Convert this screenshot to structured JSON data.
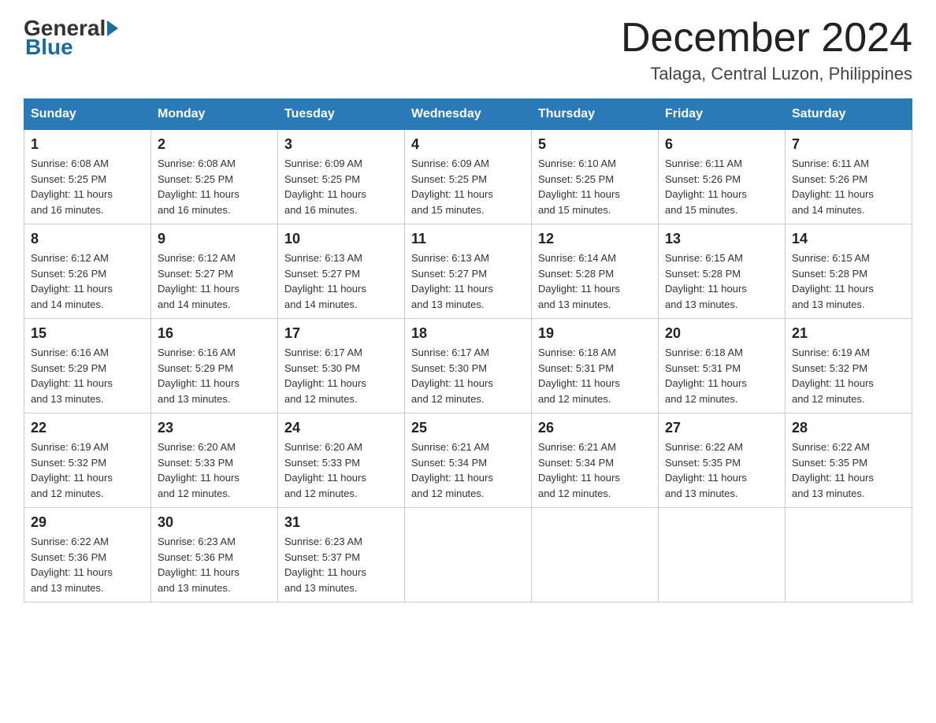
{
  "logo": {
    "general": "General",
    "blue": "Blue"
  },
  "title": "December 2024",
  "subtitle": "Talaga, Central Luzon, Philippines",
  "days_of_week": [
    "Sunday",
    "Monday",
    "Tuesday",
    "Wednesday",
    "Thursday",
    "Friday",
    "Saturday"
  ],
  "weeks": [
    [
      {
        "day": "1",
        "sunrise": "6:08 AM",
        "sunset": "5:25 PM",
        "daylight": "11 hours and 16 minutes."
      },
      {
        "day": "2",
        "sunrise": "6:08 AM",
        "sunset": "5:25 PM",
        "daylight": "11 hours and 16 minutes."
      },
      {
        "day": "3",
        "sunrise": "6:09 AM",
        "sunset": "5:25 PM",
        "daylight": "11 hours and 16 minutes."
      },
      {
        "day": "4",
        "sunrise": "6:09 AM",
        "sunset": "5:25 PM",
        "daylight": "11 hours and 15 minutes."
      },
      {
        "day": "5",
        "sunrise": "6:10 AM",
        "sunset": "5:25 PM",
        "daylight": "11 hours and 15 minutes."
      },
      {
        "day": "6",
        "sunrise": "6:11 AM",
        "sunset": "5:26 PM",
        "daylight": "11 hours and 15 minutes."
      },
      {
        "day": "7",
        "sunrise": "6:11 AM",
        "sunset": "5:26 PM",
        "daylight": "11 hours and 14 minutes."
      }
    ],
    [
      {
        "day": "8",
        "sunrise": "6:12 AM",
        "sunset": "5:26 PM",
        "daylight": "11 hours and 14 minutes."
      },
      {
        "day": "9",
        "sunrise": "6:12 AM",
        "sunset": "5:27 PM",
        "daylight": "11 hours and 14 minutes."
      },
      {
        "day": "10",
        "sunrise": "6:13 AM",
        "sunset": "5:27 PM",
        "daylight": "11 hours and 14 minutes."
      },
      {
        "day": "11",
        "sunrise": "6:13 AM",
        "sunset": "5:27 PM",
        "daylight": "11 hours and 13 minutes."
      },
      {
        "day": "12",
        "sunrise": "6:14 AM",
        "sunset": "5:28 PM",
        "daylight": "11 hours and 13 minutes."
      },
      {
        "day": "13",
        "sunrise": "6:15 AM",
        "sunset": "5:28 PM",
        "daylight": "11 hours and 13 minutes."
      },
      {
        "day": "14",
        "sunrise": "6:15 AM",
        "sunset": "5:28 PM",
        "daylight": "11 hours and 13 minutes."
      }
    ],
    [
      {
        "day": "15",
        "sunrise": "6:16 AM",
        "sunset": "5:29 PM",
        "daylight": "11 hours and 13 minutes."
      },
      {
        "day": "16",
        "sunrise": "6:16 AM",
        "sunset": "5:29 PM",
        "daylight": "11 hours and 13 minutes."
      },
      {
        "day": "17",
        "sunrise": "6:17 AM",
        "sunset": "5:30 PM",
        "daylight": "11 hours and 12 minutes."
      },
      {
        "day": "18",
        "sunrise": "6:17 AM",
        "sunset": "5:30 PM",
        "daylight": "11 hours and 12 minutes."
      },
      {
        "day": "19",
        "sunrise": "6:18 AM",
        "sunset": "5:31 PM",
        "daylight": "11 hours and 12 minutes."
      },
      {
        "day": "20",
        "sunrise": "6:18 AM",
        "sunset": "5:31 PM",
        "daylight": "11 hours and 12 minutes."
      },
      {
        "day": "21",
        "sunrise": "6:19 AM",
        "sunset": "5:32 PM",
        "daylight": "11 hours and 12 minutes."
      }
    ],
    [
      {
        "day": "22",
        "sunrise": "6:19 AM",
        "sunset": "5:32 PM",
        "daylight": "11 hours and 12 minutes."
      },
      {
        "day": "23",
        "sunrise": "6:20 AM",
        "sunset": "5:33 PM",
        "daylight": "11 hours and 12 minutes."
      },
      {
        "day": "24",
        "sunrise": "6:20 AM",
        "sunset": "5:33 PM",
        "daylight": "11 hours and 12 minutes."
      },
      {
        "day": "25",
        "sunrise": "6:21 AM",
        "sunset": "5:34 PM",
        "daylight": "11 hours and 12 minutes."
      },
      {
        "day": "26",
        "sunrise": "6:21 AM",
        "sunset": "5:34 PM",
        "daylight": "11 hours and 12 minutes."
      },
      {
        "day": "27",
        "sunrise": "6:22 AM",
        "sunset": "5:35 PM",
        "daylight": "11 hours and 13 minutes."
      },
      {
        "day": "28",
        "sunrise": "6:22 AM",
        "sunset": "5:35 PM",
        "daylight": "11 hours and 13 minutes."
      }
    ],
    [
      {
        "day": "29",
        "sunrise": "6:22 AM",
        "sunset": "5:36 PM",
        "daylight": "11 hours and 13 minutes."
      },
      {
        "day": "30",
        "sunrise": "6:23 AM",
        "sunset": "5:36 PM",
        "daylight": "11 hours and 13 minutes."
      },
      {
        "day": "31",
        "sunrise": "6:23 AM",
        "sunset": "5:37 PM",
        "daylight": "11 hours and 13 minutes."
      },
      null,
      null,
      null,
      null
    ]
  ],
  "labels": {
    "sunrise": "Sunrise:",
    "sunset": "Sunset:",
    "daylight": "Daylight:"
  }
}
